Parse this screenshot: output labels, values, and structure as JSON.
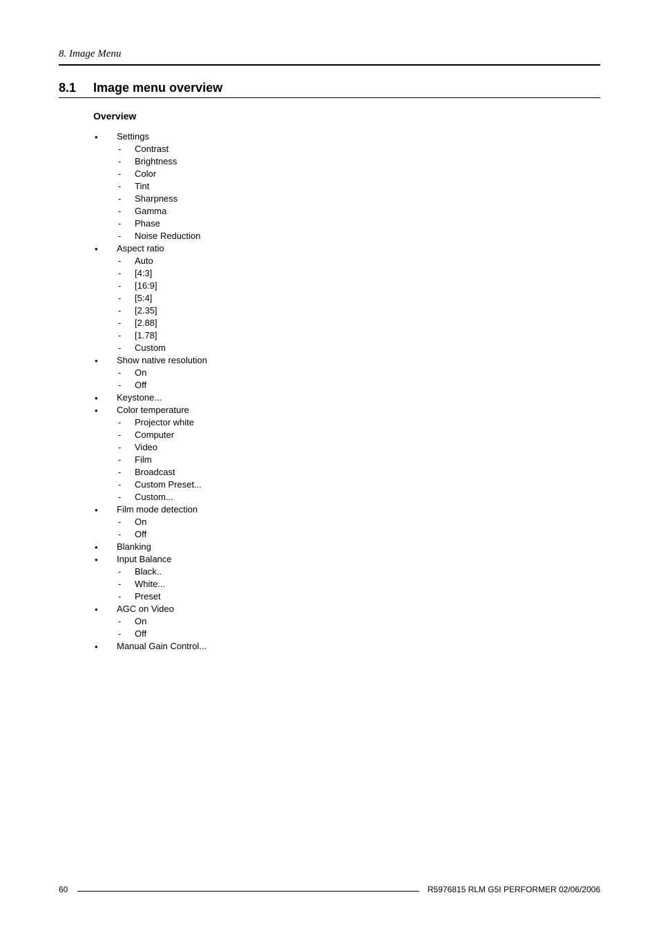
{
  "chapter_header": "8. Image Menu",
  "section": {
    "number": "8.1",
    "title": "Image menu overview"
  },
  "overview_label": "Overview",
  "items": [
    {
      "label": "Settings",
      "sub": [
        "Contrast",
        "Brightness",
        "Color",
        "Tint",
        "Sharpness",
        "Gamma",
        "Phase",
        "Noise Reduction"
      ]
    },
    {
      "label": "Aspect ratio",
      "sub": [
        "Auto",
        "[4:3]",
        "[16:9]",
        "[5:4]",
        "[2.35]",
        "[2.88]",
        "[1.78]",
        "Custom"
      ]
    },
    {
      "label": "Show native resolution",
      "sub": [
        "On",
        "Off"
      ]
    },
    {
      "label": "Keystone...",
      "sub": []
    },
    {
      "label": "Color temperature",
      "sub": [
        "Projector white",
        "Computer",
        "Video",
        "Film",
        "Broadcast",
        "Custom Preset...",
        "Custom..."
      ]
    },
    {
      "label": "Film mode detection",
      "sub": [
        "On",
        "Off"
      ]
    },
    {
      "label": "Blanking",
      "sub": []
    },
    {
      "label": "Input Balance",
      "sub": [
        "Black..",
        "White...",
        "Preset"
      ]
    },
    {
      "label": "AGC on Video",
      "sub": [
        "On",
        "Off"
      ]
    },
    {
      "label": "Manual Gain Control...",
      "sub": []
    }
  ],
  "footer": {
    "page": "60",
    "text": "R5976815  RLM G5I PERFORMER  02/06/2006"
  }
}
